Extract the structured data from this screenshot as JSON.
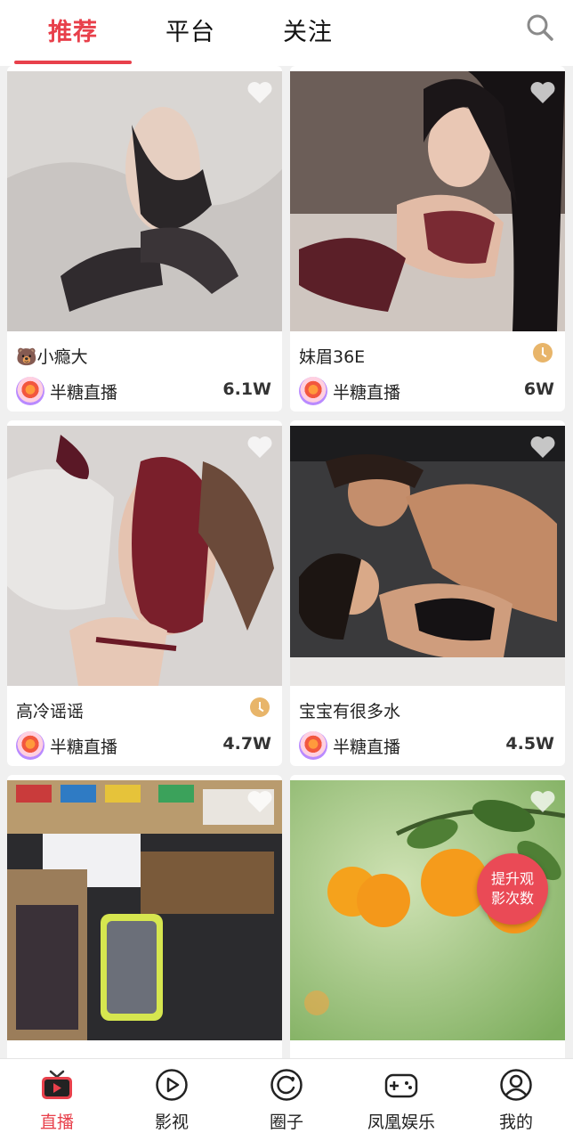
{
  "header": {
    "tabs": [
      {
        "label": "推荐",
        "active": true
      },
      {
        "label": "平台",
        "active": false
      },
      {
        "label": "关注",
        "active": false
      }
    ],
    "search_icon": "search-icon"
  },
  "cards": [
    {
      "title": "🐻小瘾大",
      "platform": "半糖直播",
      "views": "6.1W",
      "has_clock": false
    },
    {
      "title": "妹眉36E",
      "platform": "半糖直播",
      "views": "6W",
      "has_clock": true
    },
    {
      "title": "高冷谣谣",
      "platform": "半糖直播",
      "views": "4.7W",
      "has_clock": true
    },
    {
      "title": "宝宝有很多水",
      "platform": "半糖直播",
      "views": "4.5W",
      "has_clock": false
    }
  ],
  "boost_button": {
    "label": "提升观影次数"
  },
  "bottom_nav": {
    "items": [
      {
        "label": "直播",
        "icon": "tv-icon",
        "active": true
      },
      {
        "label": "影视",
        "icon": "play-circle-icon",
        "active": false
      },
      {
        "label": "圈子",
        "icon": "circle-icon",
        "active": false
      },
      {
        "label": "凤凰娱乐",
        "icon": "gamepad-icon",
        "active": false
      },
      {
        "label": "我的",
        "icon": "user-icon",
        "active": false
      }
    ]
  },
  "colors": {
    "accent": "#e8404b",
    "clock": "#e8b56a"
  }
}
